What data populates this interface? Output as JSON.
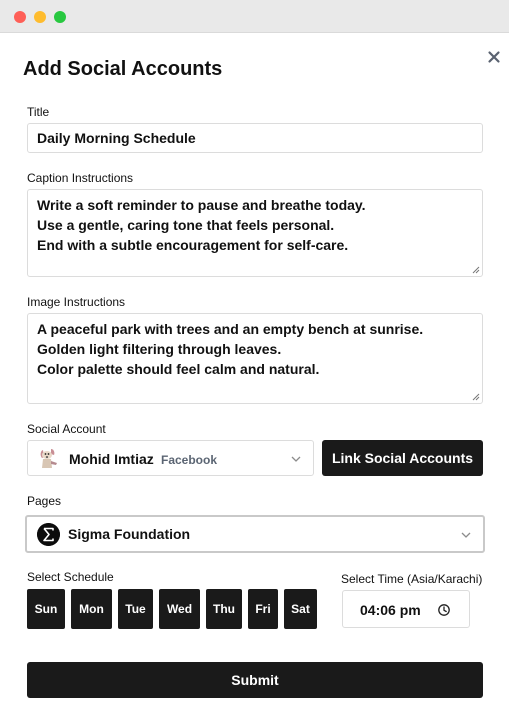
{
  "dialog": {
    "title": "Add Social Accounts"
  },
  "form": {
    "title_label": "Title",
    "title_value": "Daily Morning Schedule",
    "caption_label": "Caption Instructions",
    "caption_lines": [
      "Write a soft reminder to pause and breathe today.",
      "Use a gentle, caring tone that feels personal.",
      "End with a subtle encouragement for self-care."
    ],
    "image_label": "Image Instructions",
    "image_lines": [
      "A peaceful park with trees and an empty bench at sunrise.",
      "Golden light filtering through leaves.",
      "Color palette should feel calm and natural."
    ],
    "social_label": "Social Account",
    "social_account": {
      "name": "Mohid Imtiaz",
      "platform": "Facebook"
    },
    "link_button": "Link Social Accounts",
    "pages_label": "Pages",
    "page_selected": "Sigma Foundation",
    "schedule_label": "Select Schedule",
    "days": [
      "Sun",
      "Mon",
      "Tue",
      "Wed",
      "Thu",
      "Fri",
      "Sat"
    ],
    "time_label": "Select Time (Asia/Karachi)",
    "time_value": "04:06 pm",
    "submit": "Submit"
  },
  "icons": {
    "close": "close-icon",
    "chevron": "chevron-down-icon",
    "clock": "clock-icon",
    "account_avatar": "dog-avatar-icon",
    "page_avatar": "sigma-logo-icon"
  },
  "colors": {
    "primary": "#1a1a1a",
    "traffic_red": "#fe5f57",
    "traffic_yellow": "#febc2e",
    "traffic_green": "#28c840"
  }
}
